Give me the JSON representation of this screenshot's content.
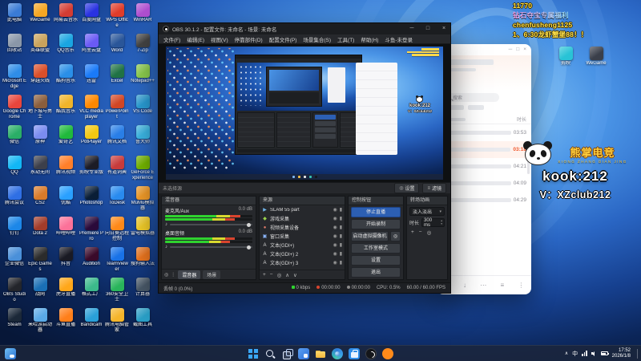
{
  "desktop": {
    "icons": [
      {
        "label": "此电脑",
        "color": "#3a7bd5"
      },
      {
        "label": "回收站",
        "color": "#8a97a8"
      },
      {
        "label": "Microsoft Edge",
        "color": "#2f8de8"
      },
      {
        "label": "Google Chrome",
        "color": "#e8453c"
      },
      {
        "label": "微信",
        "color": "#2aae67"
      },
      {
        "label": "QQ",
        "color": "#12b7f5"
      },
      {
        "label": "腾讯会议",
        "color": "#2f6fe4"
      },
      {
        "label": "钉钉",
        "color": "#1c87e8"
      },
      {
        "label": "企业微信",
        "color": "#4a90d9"
      },
      {
        "label": "OBS Studio",
        "color": "#23252b"
      },
      {
        "label": "Steam",
        "color": "#1b2838"
      },
      {
        "label": "WeGame",
        "color": "#f5a623"
      },
      {
        "label": "英雄联盟",
        "color": "#c9a35c"
      },
      {
        "label": "穿越火线",
        "color": "#d94f2a"
      },
      {
        "label": "地下城与勇士",
        "color": "#8b5e3c"
      },
      {
        "label": "原神",
        "color": "#7a8cf0"
      },
      {
        "label": "永劫无间",
        "color": "#3c3f4a"
      },
      {
        "label": "CS2",
        "color": "#d97b2a"
      },
      {
        "label": "Dota 2",
        "color": "#a33c2a"
      },
      {
        "label": "Epic Games",
        "color": "#2b2b2b"
      },
      {
        "label": "战网",
        "color": "#1a6fb5"
      },
      {
        "label": "米哈游启动器",
        "color": "#5aa9e6"
      },
      {
        "label": "网易云音乐",
        "color": "#d43c33"
      },
      {
        "label": "QQ音乐",
        "color": "#1aa5e1"
      },
      {
        "label": "酷狗音乐",
        "color": "#2a8fe8"
      },
      {
        "label": "酷我音乐",
        "color": "#f0b42a"
      },
      {
        "label": "爱奇艺",
        "color": "#20b93c"
      },
      {
        "label": "腾讯视频",
        "color": "#ff7f2a"
      },
      {
        "label": "优酷",
        "color": "#2aa0ff"
      },
      {
        "label": "哔哩哔哩",
        "color": "#fb7299"
      },
      {
        "label": "抖音",
        "color": "#1a1a24"
      },
      {
        "label": "虎牙直播",
        "color": "#ffa71a"
      },
      {
        "label": "斗鱼直播",
        "color": "#ff7f1a"
      },
      {
        "label": "百度网盘",
        "color": "#2932e1"
      },
      {
        "label": "阿里云盘",
        "color": "#6a5af5"
      },
      {
        "label": "迅雷",
        "color": "#1a7af8"
      },
      {
        "label": "VLC media player",
        "color": "#ff8800"
      },
      {
        "label": "PotPlayer",
        "color": "#f2c811"
      },
      {
        "label": "剪映专业版",
        "color": "#1c1c26"
      },
      {
        "label": "Photoshop",
        "color": "#0a1e36"
      },
      {
        "label": "Premiere Pro",
        "color": "#2a0a3a"
      },
      {
        "label": "Audition",
        "color": "#3a0a2a"
      },
      {
        "label": "格式工厂",
        "color": "#3cb98b"
      },
      {
        "label": "Bandicam",
        "color": "#2a9fd8"
      },
      {
        "label": "WPS Office",
        "color": "#e03c2a"
      },
      {
        "label": "Word",
        "color": "#2b579a"
      },
      {
        "label": "Excel",
        "color": "#217346"
      },
      {
        "label": "PowerPoint",
        "color": "#d24726"
      },
      {
        "label": "腾讯文档",
        "color": "#2a7fe8"
      },
      {
        "label": "有道词典",
        "color": "#c83c3c"
      },
      {
        "label": "ToDesk",
        "color": "#2a8cf0"
      },
      {
        "label": "向日葵远程控制",
        "color": "#ff8a1a"
      },
      {
        "label": "TeamViewer",
        "color": "#1a73e8"
      },
      {
        "label": "360安全卫士",
        "color": "#2ab55c"
      },
      {
        "label": "腾讯电脑管家",
        "color": "#f5b52a"
      },
      {
        "label": "WinRAR",
        "color": "#b04fd0"
      },
      {
        "label": "7-Zip",
        "color": "#444444"
      },
      {
        "label": "Notepad++",
        "color": "#8fd14f"
      },
      {
        "label": "VS Code",
        "color": "#2a9fd8"
      },
      {
        "label": "鲁大师",
        "color": "#3cb9e8"
      },
      {
        "label": "GeForce Experience",
        "color": "#76b900"
      },
      {
        "label": "MuMu模拟器",
        "color": "#f59e2a"
      },
      {
        "label": "雷电模拟器",
        "color": "#f5d02a"
      },
      {
        "label": "搜狗输入法",
        "color": "#f07820"
      },
      {
        "label": "计算器",
        "color": "#4a5a6a"
      },
      {
        "label": "截图工具",
        "color": "#2aa0c8"
      }
    ],
    "right_icons": [
      {
        "label": "剪映",
        "color": "#29c3d6"
      },
      {
        "label": "WeGame",
        "color": "#3a3f4a"
      }
    ]
  },
  "stream_overlay": {
    "lines": [
      "11770",
      "钻石夺宝专属福利",
      "chenfusheng1125",
      "1、6:30龙虾蟹堡88！！"
    ],
    "text_color": "#ffe24a",
    "mascot": {
      "brand": "熊掌电竞",
      "brand_sub": "XIONG ZHANG DIAN JING",
      "kook": "kook:212",
      "wechat": "V：XZclub212"
    }
  },
  "obs": {
    "title": "OBS 30.1.2 - 配置文件: 未命名 - 场景: 未命名",
    "window_controls": [
      "─",
      "□",
      "×"
    ],
    "menus": [
      "文件(F)",
      "编辑(E)",
      "视图(V)",
      "停靠部件(D)",
      "配置文件(P)",
      "场景集合(S)",
      "工具(T)",
      "帮助(H)",
      "斗鱼-未登录"
    ],
    "source_toolbar": {
      "no_source": "未选择源",
      "buttons": [
        {
          "name": "source-settings-button",
          "label": "设置",
          "glyph": "◎"
        },
        {
          "name": "source-filters-button",
          "label": "滤镜",
          "glyph": "≡"
        }
      ]
    },
    "mixer": {
      "title": "混音器",
      "channels": [
        {
          "name": "麦克风/Aux",
          "db": "0.0 dB",
          "level": 86
        },
        {
          "name": "桌面音频",
          "db": "0.0 dB",
          "level": 80
        }
      ],
      "footer_icons": [
        {
          "name": "mixer-settings-icon",
          "glyph": "◎"
        },
        {
          "name": "mixer-menu-icon",
          "glyph": "⋮"
        }
      ],
      "tabs": [
        {
          "label": "混音器",
          "active": true
        },
        {
          "label": "场景",
          "active": false
        }
      ]
    },
    "sources": {
      "title": "来源",
      "items": [
        {
          "glyph": "▶",
          "color": "#6fb3e8",
          "name": "SLAM 55 part"
        },
        {
          "glyph": "◆",
          "color": "#9ad14c",
          "name": "游戏采集"
        },
        {
          "glyph": "●",
          "color": "#e07b6a",
          "name": "视频采集设备"
        },
        {
          "glyph": "▣",
          "color": "#8ab4f8",
          "name": "窗口采集"
        },
        {
          "glyph": "A",
          "color": "#d8d8d8",
          "name": "文本(GDI+)"
        },
        {
          "glyph": "A",
          "color": "#d8d8d8",
          "name": "文本(GDI+) 2"
        },
        {
          "glyph": "A",
          "color": "#d8d8d8",
          "name": "文本(GDI+) 3"
        }
      ],
      "toolbar_icons": [
        {
          "name": "add-source-icon",
          "glyph": "+"
        },
        {
          "name": "remove-source-icon",
          "glyph": "−"
        },
        {
          "name": "source-properties-icon",
          "glyph": "◎"
        },
        {
          "name": "move-up-icon",
          "glyph": "∧"
        },
        {
          "name": "move-down-icon",
          "glyph": "∨"
        }
      ]
    },
    "controls": {
      "title": "控制按钮",
      "buttons": [
        {
          "label": "停止直播",
          "primary": true
        },
        {
          "label": "开始录制"
        },
        {
          "label": "启动虚拟摄像机",
          "gear": true
        },
        {
          "label": "工作室模式"
        },
        {
          "label": "设置"
        },
        {
          "label": "退出"
        }
      ]
    },
    "transitions": {
      "title": "转场动画",
      "selected": "淡入淡出",
      "duration_label": "时长",
      "duration_value": "300 ms",
      "toolbar_icons": [
        {
          "name": "add-transition-icon",
          "glyph": "+"
        },
        {
          "name": "remove-transition-icon",
          "glyph": "−"
        },
        {
          "name": "transition-properties-icon",
          "glyph": "◎"
        }
      ]
    },
    "statusbar": {
      "dropped": "丢帧 0 (0.0%)",
      "kbps": "0 kbps",
      "stream_time": "00:00:00",
      "record_time": "00:00:00",
      "cpu": "CPU: 0.5%",
      "fps": "60.00 / 60.00 FPS"
    }
  },
  "music": {
    "window_controls": [
      "─",
      "□",
      "×"
    ],
    "search_placeholder": "搜索",
    "duration_header": "时长",
    "rows": [
      {
        "duration": "03:53"
      },
      {
        "duration": "03:18",
        "active": true
      },
      {
        "duration": "04:21"
      },
      {
        "duration": "04:09"
      },
      {
        "duration": "04:29"
      }
    ],
    "toolbar_icons": [
      {
        "name": "heart-icon",
        "glyph": "♡"
      },
      {
        "name": "download-icon",
        "glyph": "↓"
      },
      {
        "name": "comment-icon",
        "glyph": "⋯"
      },
      {
        "name": "playlist-icon",
        "glyph": "≡"
      },
      {
        "name": "more-icon",
        "glyph": "⋮"
      }
    ]
  },
  "taskbar": {
    "icons": [
      {
        "name": "start",
        "type": "start"
      },
      {
        "name": "search",
        "type": "search"
      },
      {
        "name": "task-view",
        "type": "taskview"
      },
      {
        "name": "widgets",
        "type": "widgets"
      },
      {
        "name": "file-explorer",
        "type": "explorer"
      },
      {
        "name": "edge",
        "type": "edge"
      },
      {
        "name": "microsoft-store",
        "type": "store"
      },
      {
        "name": "obs-studio",
        "type": "obs"
      },
      {
        "name": "douyu",
        "type": "app",
        "color": "#ff8a1a"
      }
    ],
    "tray": {
      "lang": "中",
      "time": "17:52",
      "date": "2026/1/8"
    }
  }
}
